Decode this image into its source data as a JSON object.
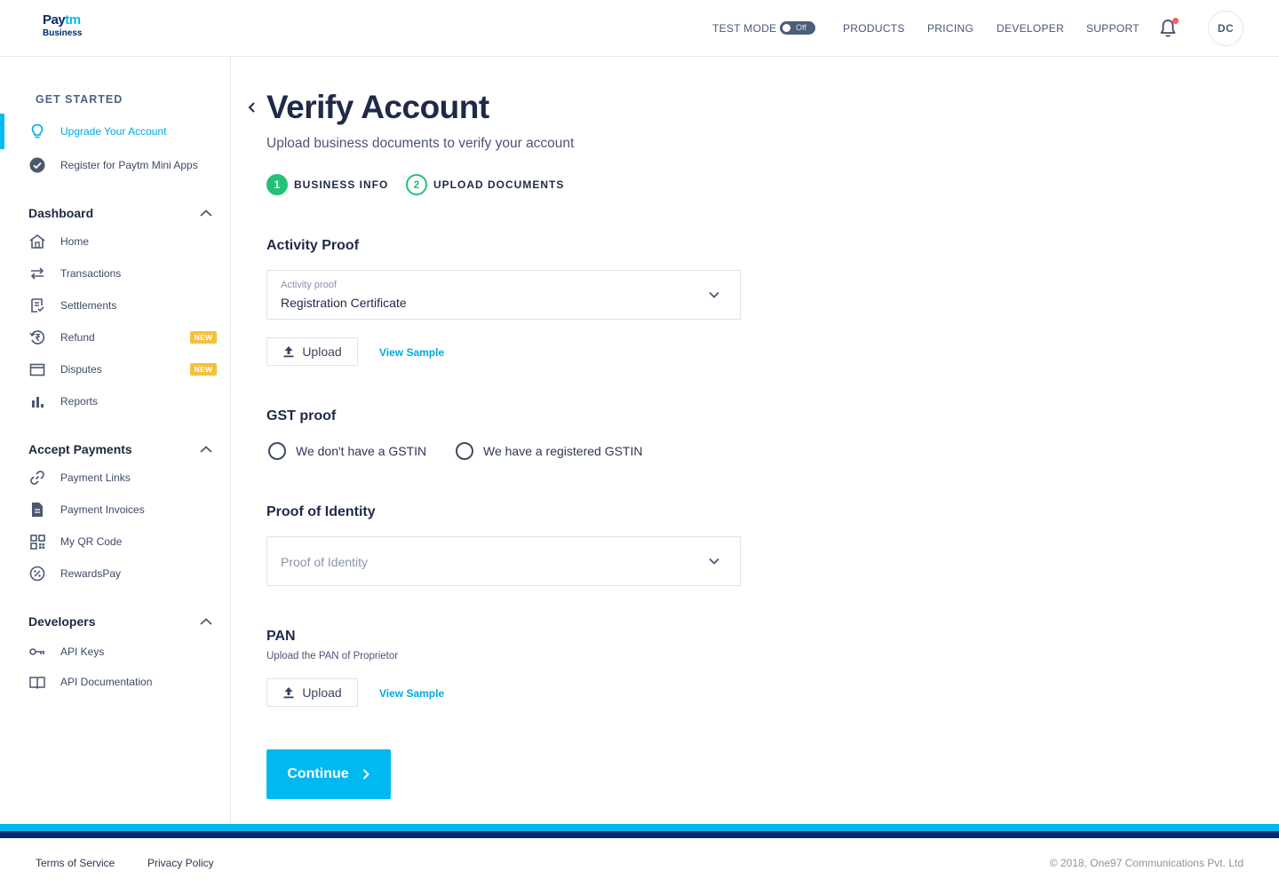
{
  "brand": {
    "logo_pay": "Pay",
    "logo_tm": "tm",
    "logo_business": "Business"
  },
  "header": {
    "test_mode_label": "TEST MODE",
    "toggle_state": "Off",
    "nav": [
      "PRODUCTS",
      "PRICING",
      "DEVELOPER",
      "SUPPORT"
    ],
    "avatar_initials": "DC",
    "has_notification": true
  },
  "sidebar": {
    "get_started": "GET STARTED",
    "get_started_items": [
      {
        "label": "Upgrade Your Account",
        "icon": "lightbulb-icon",
        "active": true
      },
      {
        "label": "Register for Paytm Mini Apps",
        "icon": "check-circle-icon",
        "active": false
      }
    ],
    "sections": [
      {
        "title": "Dashboard",
        "items": [
          {
            "label": "Home",
            "icon": "home-icon"
          },
          {
            "label": "Transactions",
            "icon": "swap-arrows-icon"
          },
          {
            "label": "Settlements",
            "icon": "settlement-icon"
          },
          {
            "label": "Refund",
            "icon": "refund-rupee-icon",
            "badge": "NEW"
          },
          {
            "label": "Disputes",
            "icon": "card-icon",
            "badge": "NEW"
          },
          {
            "label": "Reports",
            "icon": "bar-chart-icon"
          }
        ]
      },
      {
        "title": "Accept Payments",
        "items": [
          {
            "label": "Payment Links",
            "icon": "link-icon"
          },
          {
            "label": "Payment Invoices",
            "icon": "document-icon"
          },
          {
            "label": "My QR Code",
            "icon": "qr-code-icon"
          },
          {
            "label": "RewardsPay",
            "icon": "percent-badge-icon"
          }
        ]
      },
      {
        "title": "Developers",
        "items": [
          {
            "label": "API Keys",
            "icon": "key-icon"
          },
          {
            "label": "API Documentation",
            "icon": "book-icon"
          }
        ]
      }
    ]
  },
  "main": {
    "title": "Verify Account",
    "subtitle": "Upload business documents to verify your account",
    "steps": [
      {
        "num": "1",
        "label": "BUSINESS INFO",
        "state": "done"
      },
      {
        "num": "2",
        "label": "UPLOAD DOCUMENTS",
        "state": "current"
      }
    ],
    "activity_proof": {
      "title": "Activity Proof",
      "field_label": "Activity proof",
      "value": "Registration Certificate",
      "upload_label": "Upload",
      "sample_label": "View Sample"
    },
    "gst_proof": {
      "title": "GST proof",
      "options": [
        "We don't have a GSTIN",
        "We have a registered GSTIN"
      ]
    },
    "identity": {
      "title": "Proof of Identity",
      "placeholder": "Proof of Identity"
    },
    "pan": {
      "title": "PAN",
      "subtitle": "Upload the PAN of Proprietor",
      "upload_label": "Upload",
      "sample_label": "View Sample"
    },
    "continue_label": "Continue"
  },
  "footer": {
    "links": [
      "Terms of Service",
      "Privacy Policy"
    ],
    "copyright": "© 2018, One97 Communications Pvt. Ltd"
  },
  "colors": {
    "accent": "#00b9f1",
    "navy": "#012a72",
    "success": "#21c17a",
    "badge": "#f5c13b",
    "alert": "#fd5c5c"
  }
}
